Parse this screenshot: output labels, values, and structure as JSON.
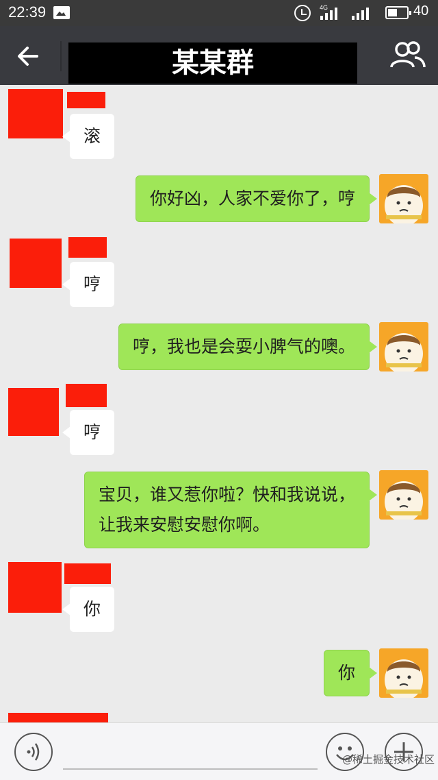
{
  "status_bar": {
    "time": "22:39",
    "network": "4G",
    "battery": "40",
    "icons": [
      "image-notification-icon",
      "alarm-icon",
      "signal-icon",
      "battery-icon"
    ]
  },
  "header": {
    "title": "某某群",
    "icons": [
      "back-arrow-icon",
      "group-members-icon"
    ]
  },
  "messages": [
    {
      "side": "in",
      "text": "滚"
    },
    {
      "side": "out",
      "text": "你好凶，人家不爱你了，哼"
    },
    {
      "side": "in",
      "text": "哼"
    },
    {
      "side": "out",
      "text": "哼，我也是会耍小脾气的噢。"
    },
    {
      "side": "in",
      "text": "哼"
    },
    {
      "side": "out",
      "lines": [
        "宝贝，谁又惹你啦？快和我说说，",
        "让我来安慰安慰你啊。"
      ]
    },
    {
      "side": "in",
      "text": "你"
    },
    {
      "side": "out",
      "text": "你"
    }
  ],
  "input_bar": {
    "text": "",
    "icons": [
      "voice-icon",
      "emoji-icon",
      "plus-icon"
    ]
  },
  "watermark": "@稀土掘金技术社区",
  "colors": {
    "status_bar": "#3a3a3a",
    "nav_bar": "#393a3f",
    "chat_background": "#ebebeb",
    "incoming_bubble": "#ffffff",
    "outgoing_bubble": "#9fe658",
    "redaction": "#fb1e0a",
    "title_redaction": "#000000"
  }
}
